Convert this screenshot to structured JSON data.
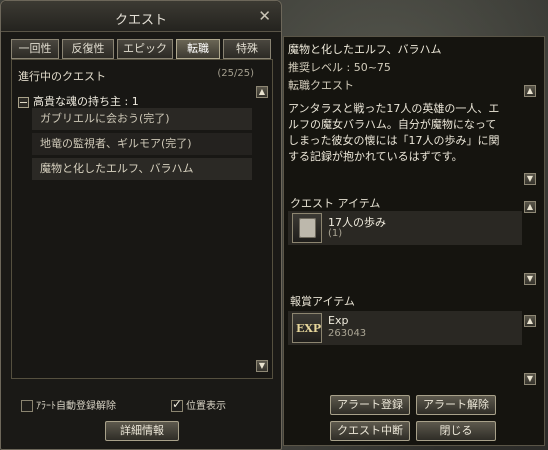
{
  "window": {
    "title": "クエスト",
    "close_icon": "close-icon"
  },
  "tabs": [
    {
      "label": "一回性",
      "active": false
    },
    {
      "label": "反復性",
      "active": false
    },
    {
      "label": "エピック",
      "active": false
    },
    {
      "label": "転職",
      "active": true
    },
    {
      "label": "特殊",
      "active": false
    }
  ],
  "list": {
    "header": "進行中のクエスト",
    "count": "(25/25)",
    "group_label": "高貴な魂の持ち主 : 1",
    "items": [
      "ガブリエルに会おう(完了)",
      "地竜の監視者、ギルモア(完了)",
      "魔物と化したエルフ、バラハム"
    ]
  },
  "options": {
    "auto_alert": "ｱﾗｰﾄ自動登録解除",
    "show_location": "位置表示",
    "auto_alert_checked": false,
    "show_location_checked": true
  },
  "detail_button": "詳細情報",
  "detail": {
    "title": "魔物と化したエルフ、バラハム",
    "level": "推奨レベル : 50~75",
    "type": "転職クエスト",
    "description": [
      "アンタラスと戦った17人の英雄の一人、エ",
      "ルフの魔女バラハム。自分が魔物になって",
      "しまった彼女の懐には「17人の歩み」に関",
      "する記録が抱かれているはずです。"
    ],
    "quest_items_header": "クエスト アイテム",
    "quest_item": {
      "name": "17人の歩み",
      "qty": "(1)",
      "icon": "scroll-icon"
    },
    "reward_header": "報賞アイテム",
    "reward_item": {
      "name": "Exp",
      "qty": "263043",
      "icon_label": "EXP"
    }
  },
  "buttons": {
    "alert_register": "アラート登録",
    "alert_release": "アラート解除",
    "abort": "クエスト中断",
    "close": "閉じる"
  },
  "colors": {
    "accent": "#b0a98f",
    "panel": "#181714",
    "text": "#d8d4c8"
  }
}
